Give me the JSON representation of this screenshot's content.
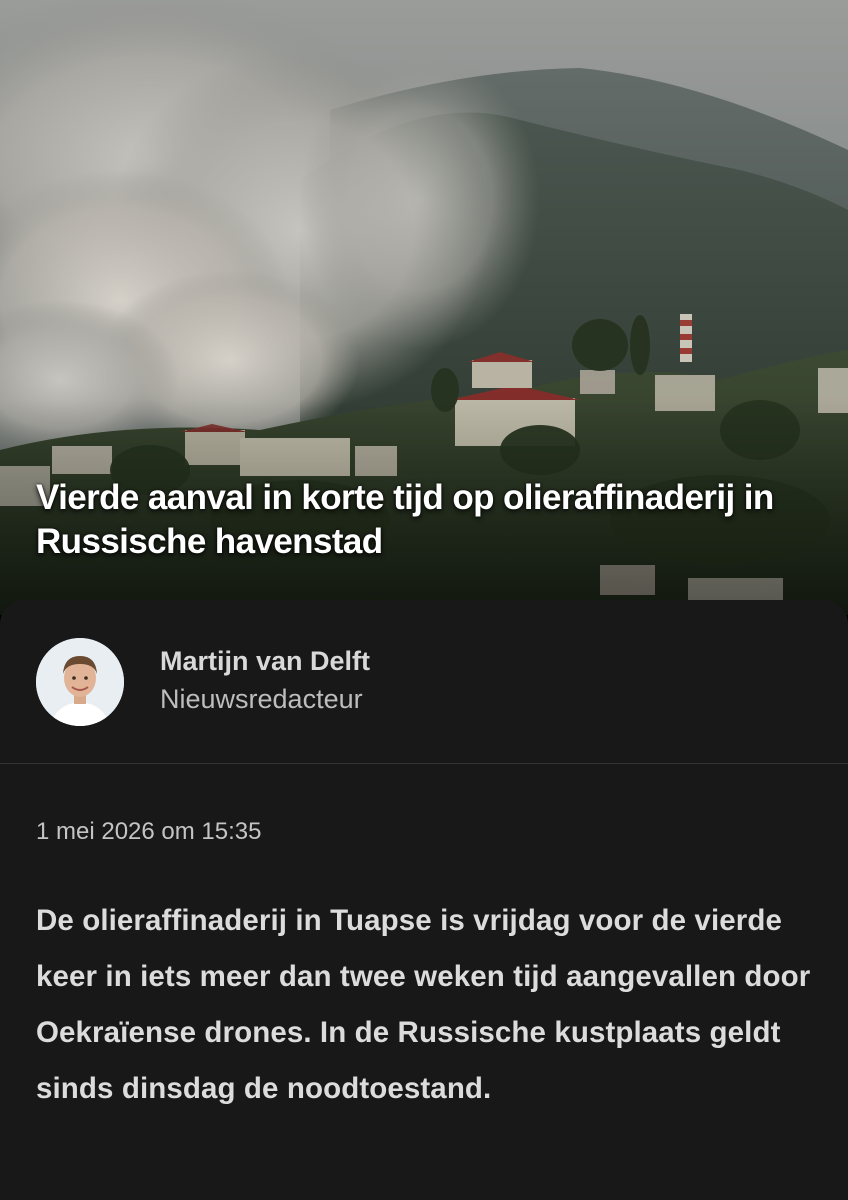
{
  "article": {
    "headline": "Vierde aanval in korte tijd op olieraffinaderij in Russische havenstad",
    "author": {
      "name": "Martijn van Delft",
      "role": "Nieuwsredacteur"
    },
    "date": "1 mei 2026 om 15:35",
    "lead": "De olieraffinaderij in Tuapse is vrijdag voor de vierde keer in iets meer dan twee weken tijd aangevallen door Oekraïense drones. In de Russische kustplaats geldt sinds dinsdag de noodtoestand."
  },
  "colors": {
    "sheet_background": "#181818",
    "text_primary": "#dcdcdc",
    "text_secondary": "#bdbdbd"
  }
}
